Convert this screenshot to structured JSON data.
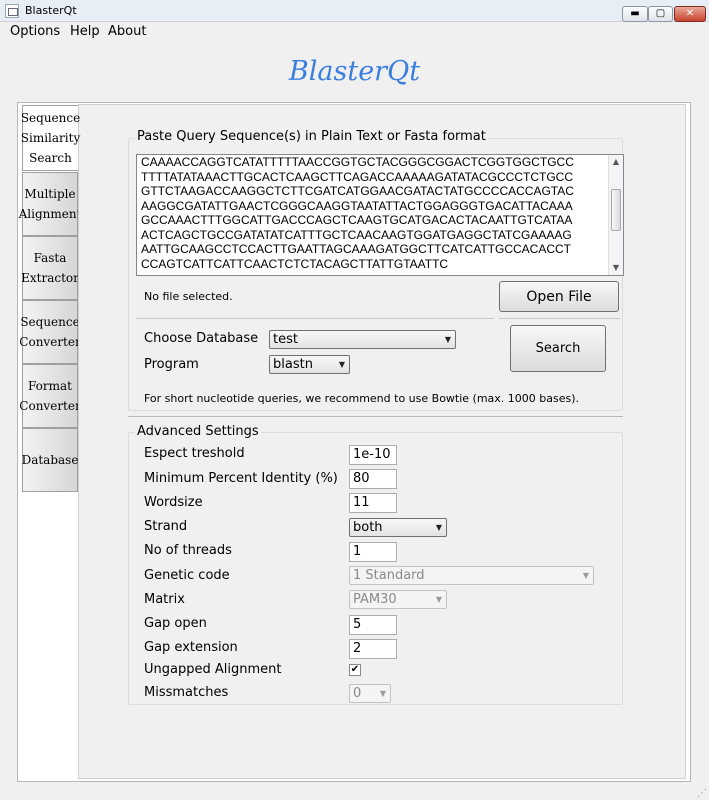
{
  "window": {
    "title": "BlasterQt",
    "controls": {
      "minimize": "▬",
      "maximize": "▢",
      "close": "✕"
    }
  },
  "menu": [
    "Options",
    "Help",
    "About"
  ],
  "app_title": "BlasterQt",
  "tabs": [
    {
      "label": "Sequence\nSimilarity\nSearch",
      "active": true
    },
    {
      "label": "Multiple\nAlignment",
      "active": false
    },
    {
      "label": "Fasta\nExtractor",
      "active": false
    },
    {
      "label": "Sequence\nConverter",
      "active": false
    },
    {
      "label": "Format\nConverter",
      "active": false
    },
    {
      "label": "Database",
      "active": false
    }
  ],
  "query": {
    "group_label": "Paste Query Sequence(s) in Plain Text or Fasta format",
    "lines": [
      "CAAAACCAGGTCATATTTTTAACCGGTGCTACGGGCGGACTCGGTGGCTGCC",
      "TTTTATATAAACTTGCACTCAAGCTTCAGACCAAAAAGATATACGCCCTCTGCC",
      "GTTCTAAGACCAAGGCTCTTCGATCATGGAACGATACTATGCCCCACCAGTAC",
      "AAGGCGATATTGAACTCGGGCAAGGTAATATTACTGGAGGGTGACATTACAAA",
      "GCCAAACTTTGGCATTGACCCAGCTCAAGTGCATGACACTACAATTGTCATAA",
      "ACTCAGCTGCCGATATATCATTTGCTCAACAAGTGGATGAGGCTATCGAAAAG",
      "AATTGCAAGCCTCCACTTGAATTAGCAAAGATGGCTTCATCATTGCCACACCT",
      "CCAGTCATTCATTCAACTCTCTACAGCTTATTGTAATTC"
    ],
    "file_status": "No file selected.",
    "open_file_button": "Open File",
    "database_label": "Choose Database",
    "database_value": "test",
    "program_label": "Program",
    "program_value": "blastn",
    "search_button": "Search",
    "note": "For short nucleotide queries, we recommend to use Bowtie (max. 1000 bases)."
  },
  "advanced": {
    "group_label": "Advanced Settings",
    "expect_label": "Espect treshold",
    "expect_value": "1e-10",
    "identity_label": "Minimum Percent Identity (%)",
    "identity_value": "80",
    "wordsize_label": "Wordsize",
    "wordsize_value": "11",
    "strand_label": "Strand",
    "strand_value": "both",
    "threads_label": "No of threads",
    "threads_value": "1",
    "genetic_code_label": "Genetic code",
    "genetic_code_value": "1 Standard",
    "matrix_label": "Matrix",
    "matrix_value": "PAM30",
    "gap_open_label": "Gap open",
    "gap_open_value": "5",
    "gap_extension_label": "Gap extension",
    "gap_extension_value": "2",
    "ungapped_label": "Ungapped Alignment",
    "ungapped_checked": true,
    "mismatches_label": "Missmatches",
    "mismatches_value": "0"
  },
  "colors": {
    "app_title": "#3a7ee0",
    "close_button": "#c7432d"
  }
}
